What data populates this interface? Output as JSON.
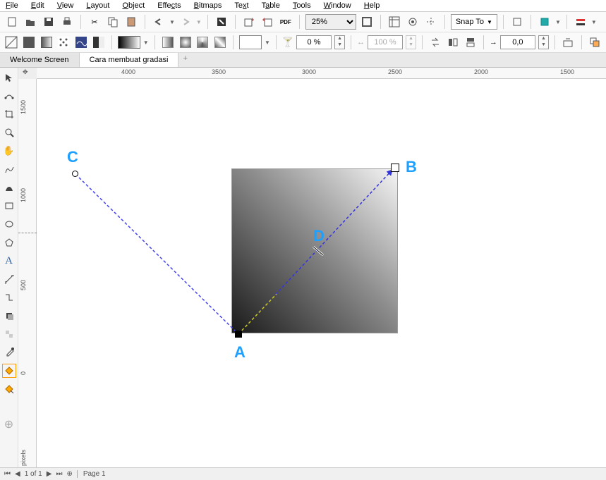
{
  "menu": {
    "file": "File",
    "edit": "Edit",
    "view": "View",
    "layout": "Layout",
    "object": "Object",
    "effects": "Effects",
    "bitmaps": "Bitmaps",
    "text": "Text",
    "table": "Table",
    "tools": "Tools",
    "window": "Window",
    "help": "Help"
  },
  "toolbar": {
    "zoom": "25%",
    "snap_to": "Snap To",
    "transparency": "0 %",
    "merge": "100 %",
    "rotate": "0,0"
  },
  "tabs": {
    "welcome": "Welcome Screen",
    "doc1": "Cara membuat gradasi"
  },
  "ruler_h": [
    "4000",
    "3500",
    "3000",
    "2500",
    "2000",
    "1500"
  ],
  "ruler_v": [
    "1500",
    "1000",
    "500",
    "0"
  ],
  "ruler_unit": "pixels",
  "annotations": {
    "a": "A",
    "b": "B",
    "c": "C",
    "d": "D"
  },
  "footer": {
    "nav": "1 of 1",
    "page": "Page 1"
  }
}
